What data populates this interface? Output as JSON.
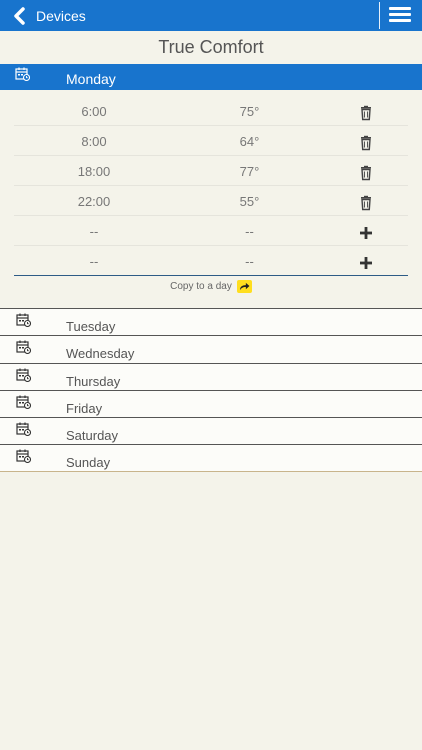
{
  "header": {
    "back_label": "Devices",
    "title": "True Comfort"
  },
  "active_day": {
    "name": "Monday",
    "entries": [
      {
        "time": "6:00",
        "temp": "75°",
        "action": "delete"
      },
      {
        "time": "8:00",
        "temp": "64°",
        "action": "delete"
      },
      {
        "time": "18:00",
        "temp": "77°",
        "action": "delete"
      },
      {
        "time": "22:00",
        "temp": "55°",
        "action": "delete"
      },
      {
        "time": "--",
        "temp": "--",
        "action": "add"
      },
      {
        "time": "--",
        "temp": "--",
        "action": "add"
      }
    ],
    "copy_label": "Copy to a day"
  },
  "other_days": [
    "Tuesday",
    "Wednesday",
    "Thursday",
    "Friday",
    "Saturday",
    "Sunday"
  ],
  "colors": {
    "accent": "#1874cd",
    "background": "#f4f3ea",
    "copy_button": "#ffde1e"
  }
}
